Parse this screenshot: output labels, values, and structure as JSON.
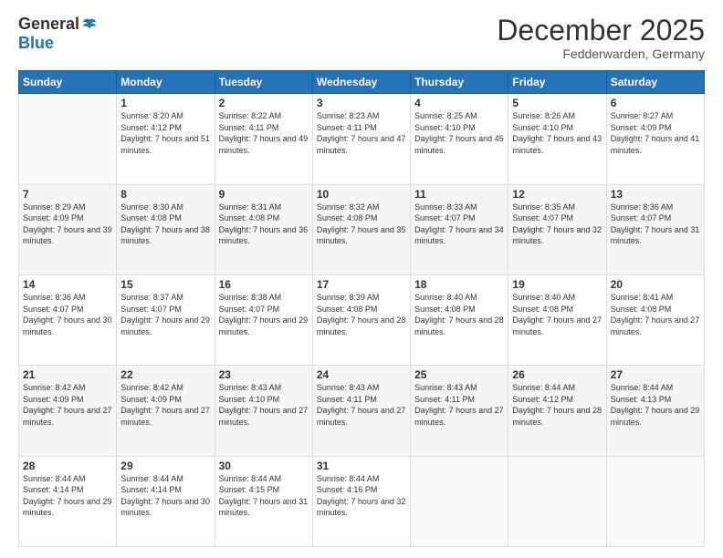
{
  "logo": {
    "general": "General",
    "blue": "Blue"
  },
  "title": "December 2025",
  "location": "Fedderwarden, Germany",
  "days_of_week": [
    "Sunday",
    "Monday",
    "Tuesday",
    "Wednesday",
    "Thursday",
    "Friday",
    "Saturday"
  ],
  "weeks": [
    [
      {
        "day": "",
        "sunrise": "",
        "sunset": "",
        "daylight": ""
      },
      {
        "day": "1",
        "sunrise": "Sunrise: 8:20 AM",
        "sunset": "Sunset: 4:12 PM",
        "daylight": "Daylight: 7 hours and 51 minutes."
      },
      {
        "day": "2",
        "sunrise": "Sunrise: 8:22 AM",
        "sunset": "Sunset: 4:11 PM",
        "daylight": "Daylight: 7 hours and 49 minutes."
      },
      {
        "day": "3",
        "sunrise": "Sunrise: 8:23 AM",
        "sunset": "Sunset: 4:11 PM",
        "daylight": "Daylight: 7 hours and 47 minutes."
      },
      {
        "day": "4",
        "sunrise": "Sunrise: 8:25 AM",
        "sunset": "Sunset: 4:10 PM",
        "daylight": "Daylight: 7 hours and 45 minutes."
      },
      {
        "day": "5",
        "sunrise": "Sunrise: 8:26 AM",
        "sunset": "Sunset: 4:10 PM",
        "daylight": "Daylight: 7 hours and 43 minutes."
      },
      {
        "day": "6",
        "sunrise": "Sunrise: 8:27 AM",
        "sunset": "Sunset: 4:09 PM",
        "daylight": "Daylight: 7 hours and 41 minutes."
      }
    ],
    [
      {
        "day": "7",
        "sunrise": "Sunrise: 8:29 AM",
        "sunset": "Sunset: 4:09 PM",
        "daylight": "Daylight: 7 hours and 39 minutes."
      },
      {
        "day": "8",
        "sunrise": "Sunrise: 8:30 AM",
        "sunset": "Sunset: 4:08 PM",
        "daylight": "Daylight: 7 hours and 38 minutes."
      },
      {
        "day": "9",
        "sunrise": "Sunrise: 8:31 AM",
        "sunset": "Sunset: 4:08 PM",
        "daylight": "Daylight: 7 hours and 36 minutes."
      },
      {
        "day": "10",
        "sunrise": "Sunrise: 8:32 AM",
        "sunset": "Sunset: 4:08 PM",
        "daylight": "Daylight: 7 hours and 35 minutes."
      },
      {
        "day": "11",
        "sunrise": "Sunrise: 8:33 AM",
        "sunset": "Sunset: 4:07 PM",
        "daylight": "Daylight: 7 hours and 34 minutes."
      },
      {
        "day": "12",
        "sunrise": "Sunrise: 8:35 AM",
        "sunset": "Sunset: 4:07 PM",
        "daylight": "Daylight: 7 hours and 32 minutes."
      },
      {
        "day": "13",
        "sunrise": "Sunrise: 8:36 AM",
        "sunset": "Sunset: 4:07 PM",
        "daylight": "Daylight: 7 hours and 31 minutes."
      }
    ],
    [
      {
        "day": "14",
        "sunrise": "Sunrise: 8:36 AM",
        "sunset": "Sunset: 4:07 PM",
        "daylight": "Daylight: 7 hours and 30 minutes."
      },
      {
        "day": "15",
        "sunrise": "Sunrise: 8:37 AM",
        "sunset": "Sunset: 4:07 PM",
        "daylight": "Daylight: 7 hours and 29 minutes."
      },
      {
        "day": "16",
        "sunrise": "Sunrise: 8:38 AM",
        "sunset": "Sunset: 4:07 PM",
        "daylight": "Daylight: 7 hours and 29 minutes."
      },
      {
        "day": "17",
        "sunrise": "Sunrise: 8:39 AM",
        "sunset": "Sunset: 4:08 PM",
        "daylight": "Daylight: 7 hours and 28 minutes."
      },
      {
        "day": "18",
        "sunrise": "Sunrise: 8:40 AM",
        "sunset": "Sunset: 4:08 PM",
        "daylight": "Daylight: 7 hours and 28 minutes."
      },
      {
        "day": "19",
        "sunrise": "Sunrise: 8:40 AM",
        "sunset": "Sunset: 4:08 PM",
        "daylight": "Daylight: 7 hours and 27 minutes."
      },
      {
        "day": "20",
        "sunrise": "Sunrise: 8:41 AM",
        "sunset": "Sunset: 4:08 PM",
        "daylight": "Daylight: 7 hours and 27 minutes."
      }
    ],
    [
      {
        "day": "21",
        "sunrise": "Sunrise: 8:42 AM",
        "sunset": "Sunset: 4:09 PM",
        "daylight": "Daylight: 7 hours and 27 minutes."
      },
      {
        "day": "22",
        "sunrise": "Sunrise: 8:42 AM",
        "sunset": "Sunset: 4:09 PM",
        "daylight": "Daylight: 7 hours and 27 minutes."
      },
      {
        "day": "23",
        "sunrise": "Sunrise: 8:43 AM",
        "sunset": "Sunset: 4:10 PM",
        "daylight": "Daylight: 7 hours and 27 minutes."
      },
      {
        "day": "24",
        "sunrise": "Sunrise: 8:43 AM",
        "sunset": "Sunset: 4:11 PM",
        "daylight": "Daylight: 7 hours and 27 minutes."
      },
      {
        "day": "25",
        "sunrise": "Sunrise: 8:43 AM",
        "sunset": "Sunset: 4:11 PM",
        "daylight": "Daylight: 7 hours and 27 minutes."
      },
      {
        "day": "26",
        "sunrise": "Sunrise: 8:44 AM",
        "sunset": "Sunset: 4:12 PM",
        "daylight": "Daylight: 7 hours and 28 minutes."
      },
      {
        "day": "27",
        "sunrise": "Sunrise: 8:44 AM",
        "sunset": "Sunset: 4:13 PM",
        "daylight": "Daylight: 7 hours and 29 minutes."
      }
    ],
    [
      {
        "day": "28",
        "sunrise": "Sunrise: 8:44 AM",
        "sunset": "Sunset: 4:14 PM",
        "daylight": "Daylight: 7 hours and 29 minutes."
      },
      {
        "day": "29",
        "sunrise": "Sunrise: 8:44 AM",
        "sunset": "Sunset: 4:14 PM",
        "daylight": "Daylight: 7 hours and 30 minutes."
      },
      {
        "day": "30",
        "sunrise": "Sunrise: 8:44 AM",
        "sunset": "Sunset: 4:15 PM",
        "daylight": "Daylight: 7 hours and 31 minutes."
      },
      {
        "day": "31",
        "sunrise": "Sunrise: 8:44 AM",
        "sunset": "Sunset: 4:16 PM",
        "daylight": "Daylight: 7 hours and 32 minutes."
      },
      {
        "day": "",
        "sunrise": "",
        "sunset": "",
        "daylight": ""
      },
      {
        "day": "",
        "sunrise": "",
        "sunset": "",
        "daylight": ""
      },
      {
        "day": "",
        "sunrise": "",
        "sunset": "",
        "daylight": ""
      }
    ]
  ]
}
